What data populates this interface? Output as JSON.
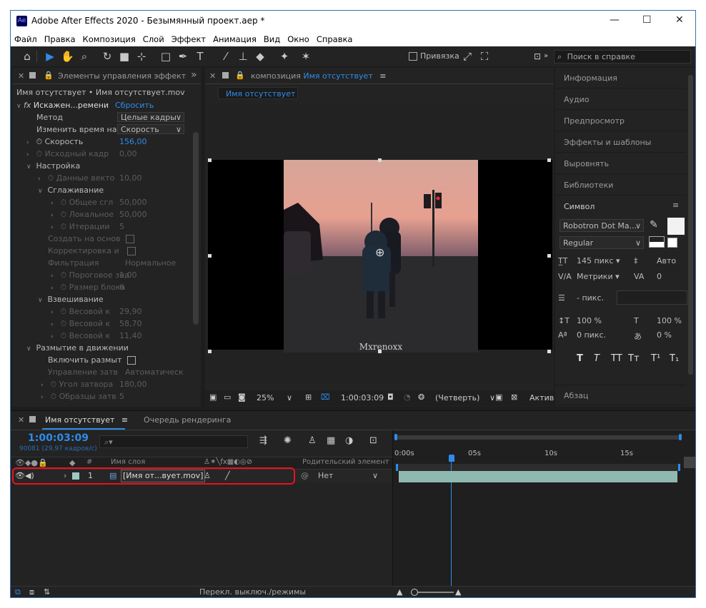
{
  "window": {
    "title": "Adobe After Effects 2020 - Безымянный проект.aep *",
    "app_icon": "Ae",
    "minimize": "—",
    "maximize": "☐",
    "close": "✕"
  },
  "menu": [
    "Файл",
    "Правка",
    "Композиция",
    "Слой",
    "Эффект",
    "Анимация",
    "Вид",
    "Окно",
    "Справка"
  ],
  "toolbar": {
    "snap_label": "Привязка",
    "search_placeholder": "Поиск в справке"
  },
  "effect_controls": {
    "tab_label": "Элементы управления эффекта",
    "subtitle": "Имя отсутствует • Имя отсутствует.mov",
    "effect_name": "Искажен...ремени",
    "reset": "Сбросить",
    "method_label": "Метод",
    "method_value": "Целые кадры",
    "remap_label": "Изменить время на",
    "remap_value": "Скорость",
    "speed_label": "Скорость",
    "speed_value": "156,00",
    "source_frame_label": "Исходный кадр",
    "source_frame_value": "0,00",
    "tuning_label": "Настройка",
    "data_label": "Данные векто",
    "data_value": "10,00",
    "smoothing_label": "Сглаживание",
    "global_label": "Общее сгл",
    "global_value": "50,000",
    "local_label": "Локальное",
    "local_value": "50,000",
    "iter_label": "Итерации",
    "iter_value": "5",
    "create_label": "Создать на основ",
    "correct_label": "Корректировка и",
    "filter_label": "Фильтрация",
    "filter_value": "Нормальное",
    "threshold_label": "Пороговое зна",
    "threshold_value": "1,00",
    "block_label": "Размер блока",
    "block_value": "6",
    "weight_label": "Взвешивание",
    "w1_label": "Весовой к",
    "w1_value": "29,90",
    "w2_label": "Весовой к",
    "w2_value": "58,70",
    "w3_label": "Весовой к",
    "w3_value": "11,40",
    "motion_blur_label": "Размытие в движении",
    "enable_blur_label": "Включить размыт",
    "shutter_label": "Управление затв",
    "shutter_value": "Автоматическ",
    "shutter_angle_label": "Угол затвора",
    "shutter_angle_value": "180,00",
    "samples_label": "Образцы затв",
    "samples_value": "5"
  },
  "composition": {
    "tab_prefix": "композиция",
    "tab_name": "Имя отсутствует",
    "breadcrumb": "Имя отсутствует",
    "watermark": "Mxrenoxx",
    "zoom": "25%",
    "timecode": "1:00:03:09",
    "resolution": "(Четверть)",
    "active_label": "Актив"
  },
  "right_panels": [
    "Информация",
    "Аудио",
    "Предпросмотр",
    "Эффекты и шаблоны",
    "Выровнять",
    "Библиотеки"
  ],
  "character": {
    "title": "Символ",
    "font": "Robotron Dot Ma...",
    "style": "Regular",
    "size": "145 пикс ▾",
    "leading": "Авто",
    "kerning": "Метрики ▾",
    "tracking": "0",
    "stroke": "- пикс.",
    "vscale": "100 %",
    "hscale": "100 %",
    "baseline": "0 пикс.",
    "tsume": "0 %",
    "styles": [
      "T",
      "T",
      "TT",
      "Tт",
      "T¹",
      "T₁"
    ],
    "paragraph": "Абзац"
  },
  "timeline": {
    "tab_name": "Имя отсутствует",
    "render_queue": "Очередь рендеринга",
    "timecode": "1:00:03:09",
    "frames": "90081 (29,97 кадров/с)",
    "col_hash": "#",
    "col_name": "Имя слоя",
    "col_parent": "Родительский элемент ...",
    "layer_num": "1",
    "layer_name": "[Имя от...вует.mov]",
    "parent_value": "Нет",
    "ruler": [
      "0:00s",
      "05s",
      "10s",
      "15s"
    ],
    "footer": "Перекл. выключ./режимы"
  },
  "colors": {
    "accent": "#2d8ceb",
    "highlight": "#e8121e",
    "layer_bar": "#8fb8b0"
  }
}
